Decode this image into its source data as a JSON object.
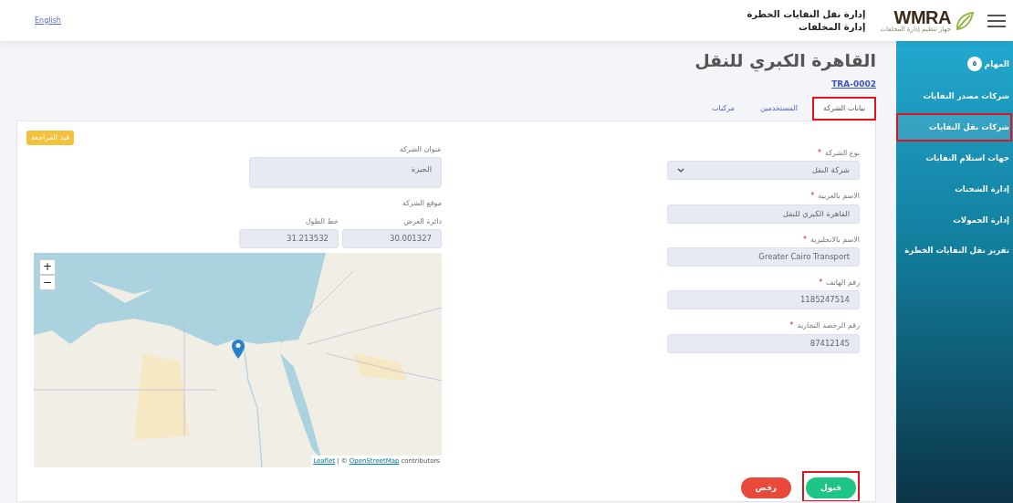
{
  "header": {
    "language": "English",
    "logo": {
      "text": "WMRA",
      "subtitle": "جهاز تنظيم إدارة المخلفات"
    },
    "titles": [
      "إدارة نقل النفايات الخطرة",
      "إدارة المخلفات"
    ]
  },
  "sidebar": {
    "items": [
      {
        "label": "المهام",
        "badge": "٥",
        "selected": false,
        "highlighted": false
      },
      {
        "label": "شركات مصدر النفايات",
        "selected": false,
        "highlighted": false
      },
      {
        "label": "شركات نقل النفايات",
        "selected": true,
        "highlighted": true
      },
      {
        "label": "جهات استلام النفايات",
        "selected": false,
        "highlighted": false
      },
      {
        "label": "إدارة الشحنات",
        "selected": false,
        "highlighted": false
      },
      {
        "label": "إدارة الحمولات",
        "selected": false,
        "highlighted": false
      },
      {
        "label": "تقرير نقل النفايات الخطرة",
        "selected": false,
        "highlighted": false
      }
    ]
  },
  "page": {
    "title": "القاهرة الكبري للنقل",
    "code": "TRA-0002"
  },
  "tabs": [
    {
      "label": "بيانات الشركة",
      "selected": true,
      "highlighted": true
    },
    {
      "label": "المستخدمين",
      "selected": false,
      "highlighted": false
    },
    {
      "label": "مركبات",
      "selected": false,
      "highlighted": false
    }
  ],
  "status_badge": "قيد المراجعة",
  "form": {
    "required_mark": "*",
    "fields": [
      {
        "label": "نوع الشركة",
        "required": true,
        "kind": "select",
        "value": "شركة النقل"
      },
      {
        "label": "الاسم بالعربية",
        "required": true,
        "kind": "text",
        "value": "القاهرة الكبري للنقل"
      },
      {
        "label": "الاسم بالانجليزية",
        "required": true,
        "kind": "text",
        "value": "Greater Cairo Transport"
      },
      {
        "label": "رقم الهاتف",
        "required": true,
        "kind": "text",
        "value": "1185247514"
      },
      {
        "label": "رقم الرخصة التجارية",
        "required": true,
        "kind": "text",
        "value": "87412145"
      }
    ]
  },
  "address": {
    "label": "عنوان الشركة",
    "value": "الجيزة"
  },
  "location": {
    "label": "موقع الشركة",
    "latitude": {
      "label": "دائرة العرض",
      "value": "30.001327"
    },
    "longitude": {
      "label": "خط الطول",
      "value": "31.213532"
    }
  },
  "map": {
    "zoom_in": "+",
    "zoom_out": "−",
    "attribution": {
      "leaflet_link": "Leaflet",
      "separator": "| ©",
      "osm_link": "OpenStreetMap",
      "suffix": "contributors"
    }
  },
  "actions": [
    {
      "label": "قبول",
      "kind": "accept",
      "highlighted": true
    },
    {
      "label": "رفض",
      "kind": "reject",
      "highlighted": false
    }
  ]
}
